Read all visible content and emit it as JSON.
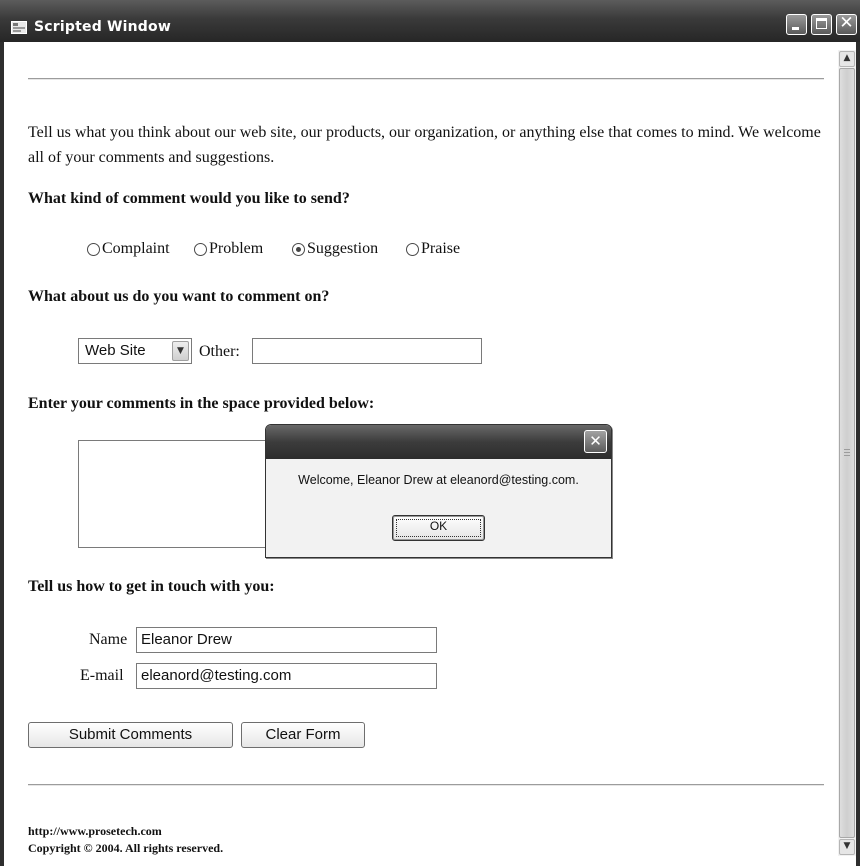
{
  "window": {
    "title": "Scripted Window",
    "icons": {
      "app": "app-window-icon",
      "minimize": "minimize-icon",
      "maximize": "maximize-icon",
      "close": "close-icon"
    },
    "close_glyph": "✕"
  },
  "page": {
    "intro": "Tell us what you think about our web site, our products, our organization, or anything else that comes to mind. We welcome all of your comments and suggestions.",
    "q_kind": "What kind of comment would you like to send?",
    "comment_kinds": [
      {
        "label": "Complaint",
        "checked": false
      },
      {
        "label": "Problem",
        "checked": false
      },
      {
        "label": "Suggestion",
        "checked": true
      },
      {
        "label": "Praise",
        "checked": false
      }
    ],
    "q_about": "What about us do you want to comment on?",
    "about_selected": "Web Site",
    "other_label": "Other:",
    "other_value": "",
    "q_comments": "Enter your comments in the space provided below:",
    "comments_value": "",
    "q_contact": "Tell us how to get in touch with you:",
    "name_label": "Name",
    "name_value": "Eleanor Drew",
    "email_label": "E-mail",
    "email_value": "eleanord@testing.com",
    "submit_label": "Submit Comments",
    "clear_label": "Clear Form",
    "footer_url": "http://www.prosetech.com",
    "footer_copyright": "Copyright © 2004. All rights reserved."
  },
  "dialog": {
    "message": "Welcome, Eleanor Drew at eleanord@testing.com.",
    "ok_label": "OK"
  },
  "scrollbar": {
    "up_glyph": "▲",
    "down_glyph": "▼"
  },
  "colors": {
    "titlebar": "#3a3a3a",
    "background": "#ffffff",
    "dialog_bg": "#f2f2f2"
  }
}
